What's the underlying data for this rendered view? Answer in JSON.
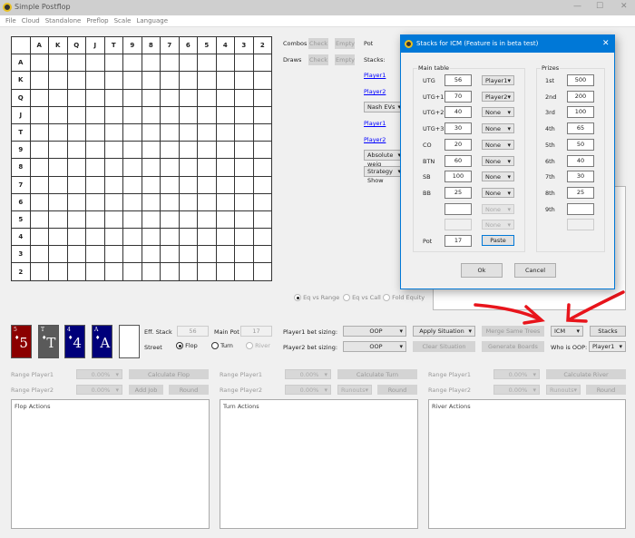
{
  "window": {
    "title": "Simple Postflop"
  },
  "menu": [
    "File",
    "Cloud",
    "Standalone",
    "Preflop",
    "Scale",
    "Language"
  ],
  "grid": {
    "ranks": [
      "A",
      "K",
      "Q",
      "J",
      "T",
      "9",
      "8",
      "7",
      "6",
      "5",
      "4",
      "3",
      "2"
    ]
  },
  "side": {
    "combos": "Combos",
    "draws": "Draws",
    "check": "Check",
    "empty": "Empty",
    "pot": "Pot",
    "stacks": "Stacks:",
    "player1": "Player1",
    "player2": "Player2",
    "nash_evs": "Nash EVs",
    "absolute": "Absolute weig",
    "strategy": "Strategy Show"
  },
  "equity": {
    "options": [
      "Eq vs Range",
      "Eq vs Call",
      "Fold Equity"
    ]
  },
  "board": {
    "cards": [
      {
        "rank": "5",
        "color": "#8b0000"
      },
      {
        "rank": "T",
        "color": "#5a5a5a"
      },
      {
        "rank": "4",
        "color": "#00007a"
      },
      {
        "rank": "A",
        "color": "#00007a"
      }
    ]
  },
  "controls": {
    "eff_stack_label": "Eff. Stack",
    "eff_stack": "56",
    "main_pot_label": "Main Pot",
    "main_pot": "17",
    "street_label": "Street",
    "streets": [
      "Flop",
      "Turn",
      "River"
    ],
    "p1_sizing": "Player1 bet sizing:",
    "p2_sizing": "Player2 bet sizing:",
    "oop": "OOP",
    "apply": "Apply Situation",
    "clear": "Clear Situation",
    "merge": "Merge Same Trees",
    "generate": "Generate Boards",
    "icm": "ICM",
    "stacks": "Stacks",
    "who_oop": "Who is OOP:",
    "who_oop_value": "Player1"
  },
  "ranges": {
    "p1": "Range Player1",
    "p2": "Range Player2",
    "pct": "0.00%",
    "calc_flop": "Calculate Flop",
    "calc_turn": "Calculate Turn",
    "calc_river": "Calculate River",
    "add_job": "Add Job",
    "round": "Round",
    "runouts": "Runouts"
  },
  "panels": [
    "Flop Actions",
    "Turn Actions",
    "River Actions"
  ],
  "dialog": {
    "title": "Stacks for ICM (Feature is in beta test)",
    "main_table": "Main table",
    "prizes": "Prizes",
    "positions": [
      {
        "pos": "UTG",
        "stack": "56",
        "player": "Player1"
      },
      {
        "pos": "UTG+1",
        "stack": "70",
        "player": "Player2"
      },
      {
        "pos": "UTG+2",
        "stack": "40",
        "player": "None"
      },
      {
        "pos": "UTG+3",
        "stack": "30",
        "player": "None"
      },
      {
        "pos": "CO",
        "stack": "20",
        "player": "None"
      },
      {
        "pos": "BTN",
        "stack": "60",
        "player": "None"
      },
      {
        "pos": "SB",
        "stack": "100",
        "player": "None"
      },
      {
        "pos": "BB",
        "stack": "25",
        "player": "None"
      },
      {
        "pos": "",
        "stack": "",
        "player": "None"
      },
      {
        "pos": "",
        "stack": "",
        "player": "None"
      }
    ],
    "pot_label": "Pot",
    "pot": "17",
    "paste": "Paste",
    "prize_list": [
      {
        "place": "1st",
        "value": "500"
      },
      {
        "place": "2nd",
        "value": "200"
      },
      {
        "place": "3rd",
        "value": "100"
      },
      {
        "place": "4th",
        "value": "65"
      },
      {
        "place": "5th",
        "value": "50"
      },
      {
        "place": "6th",
        "value": "40"
      },
      {
        "place": "7th",
        "value": "30"
      },
      {
        "place": "8th",
        "value": "25"
      },
      {
        "place": "9th",
        "value": ""
      },
      {
        "place": "",
        "value": ""
      }
    ],
    "ok": "Ok",
    "cancel": "Cancel"
  },
  "annotation_color": "#e8141b"
}
